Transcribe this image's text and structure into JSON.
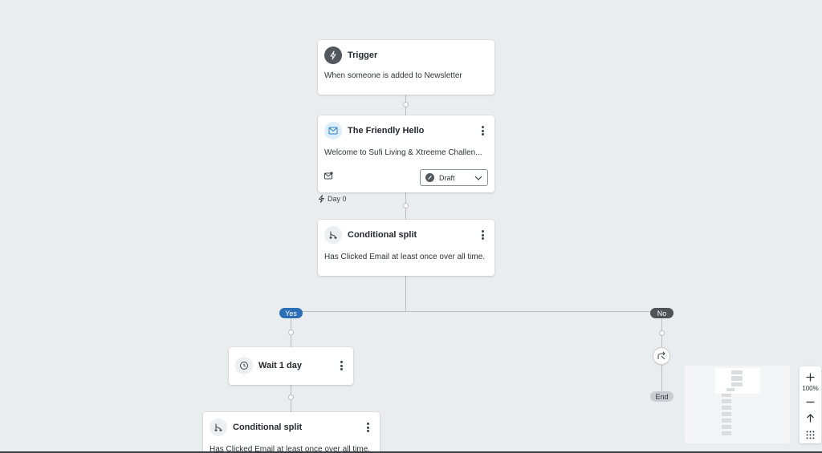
{
  "trigger": {
    "title": "Trigger",
    "description": "When someone is added to Newsletter",
    "icon": "lightning-icon"
  },
  "email_step": {
    "title": "The Friendly Hello",
    "description": "Welcome to Sufi Living & Xtreeme Challen...",
    "icon": "envelope-icon",
    "status": "Draft"
  },
  "delay_marker": {
    "label": "Day 0"
  },
  "split_1": {
    "title": "Conditional split",
    "description": "Has Clicked Email at least once over all time.",
    "icon": "split-icon"
  },
  "branches": {
    "yes": "Yes",
    "no": "No",
    "end": "End"
  },
  "wait_step": {
    "title": "Wait 1 day",
    "icon": "clock-icon"
  },
  "split_2": {
    "title": "Conditional split",
    "description": "Has Clicked Email at least once over all time.",
    "icon": "split-icon"
  },
  "zoom": {
    "level": "100%"
  },
  "colors": {
    "canvas": "#eaedf0",
    "yes_pill": "#2d6fb7",
    "no_pill": "#4f5358",
    "end_pill": "#c9cdd2",
    "connector": "#b9bec4"
  }
}
